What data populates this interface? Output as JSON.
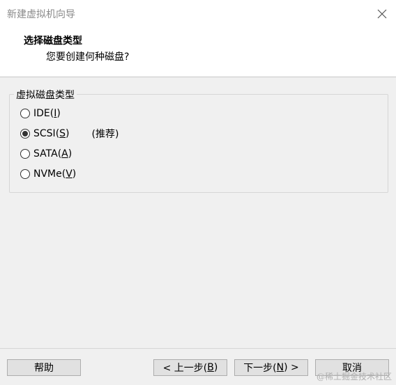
{
  "window": {
    "title": "新建虚拟机向导"
  },
  "header": {
    "title": "选择磁盘类型",
    "subtitle": "您要创建何种磁盘?"
  },
  "disk_type_group": {
    "label": "虚拟磁盘类型",
    "options": [
      {
        "label": "IDE",
        "accel": "I",
        "selected": false
      },
      {
        "label": "SCSI",
        "accel": "S",
        "selected": true,
        "note": "(推荐)"
      },
      {
        "label": "SATA",
        "accel": "A",
        "selected": false
      },
      {
        "label": "NVMe",
        "accel": "V",
        "selected": false
      }
    ]
  },
  "buttons": {
    "help": "帮助",
    "back_prefix": "< 上一步(",
    "back_accel": "B",
    "back_suffix": ")",
    "next_prefix": "下一步(",
    "next_accel": "N",
    "next_suffix": ") >",
    "cancel": "取消"
  },
  "watermark": "@稀土掘金技术社区"
}
